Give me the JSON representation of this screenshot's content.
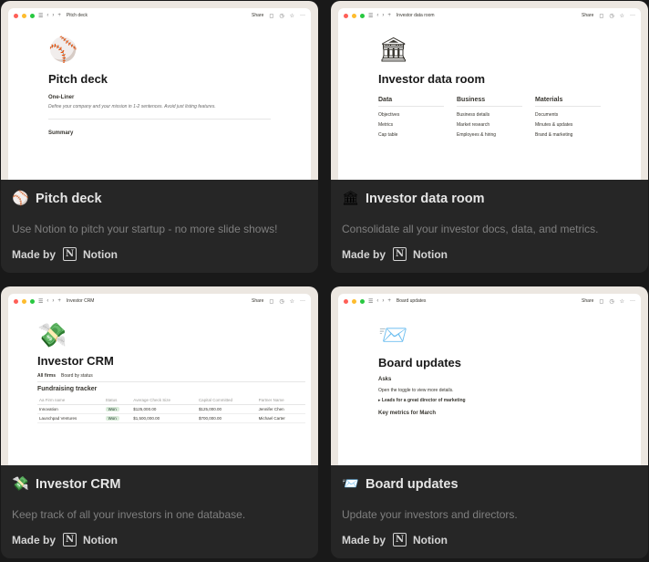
{
  "made_by_label": "Made by",
  "brand_name": "Notion",
  "browser": {
    "share_label": "Share"
  },
  "cards": [
    {
      "title": "Pitch deck",
      "emoji": "⚾",
      "description": "Use Notion to pitch your startup - no more slide shows!",
      "preview": {
        "tab_title": "Pitch deck",
        "doc_title": "Pitch deck",
        "heading1": "One-Liner",
        "paragraph": "Define your company and your mission in 1-2 sentences. Avoid just listing features.",
        "heading2": "Summary"
      }
    },
    {
      "title": "Investor data room",
      "emoji": "🏛",
      "description": "Consolidate all your investor docs, data, and metrics.",
      "preview": {
        "tab_title": "Investor data room",
        "doc_title": "Investor data room",
        "columns": [
          {
            "heading": "Data",
            "items": [
              "Objectives",
              "Metrics",
              "Cap table"
            ]
          },
          {
            "heading": "Business",
            "items": [
              "Business details",
              "Market research",
              "Employees & hiring"
            ]
          },
          {
            "heading": "Materials",
            "items": [
              "Documents",
              "Minutes & updates",
              "Brand & marketing"
            ]
          }
        ]
      }
    },
    {
      "title": "Investor CRM",
      "emoji": "💸",
      "description": "Keep track of all your investors in one database.",
      "preview": {
        "tab_title": "Investor CRM",
        "doc_title": "Investor CRM",
        "tabs": [
          "All firms",
          "Board by status"
        ],
        "subhead": "Fundraising tracker",
        "table_headers": [
          "Aa Firm name",
          "Status",
          "Average Check Size",
          "Capital Committed",
          "Partner Name"
        ],
        "rows": [
          [
            "Innovation",
            "Won",
            "$125,000.00",
            "$125,000.00",
            "Jennifer Chen"
          ],
          [
            "Launchpad Ventures",
            "Won",
            "$1,500,000.00",
            "$700,000.00",
            "Michael Carter"
          ]
        ]
      }
    },
    {
      "title": "Board updates",
      "emoji": "📨",
      "description": "Update your investors and directors.",
      "preview": {
        "tab_title": "Board updates",
        "doc_title": "Board updates",
        "section1": "Asks",
        "toggle_hint": "Open the toggle to view more details.",
        "toggle_item": "Leads for a great director of marketing",
        "section2": "Key metrics for March"
      }
    }
  ]
}
